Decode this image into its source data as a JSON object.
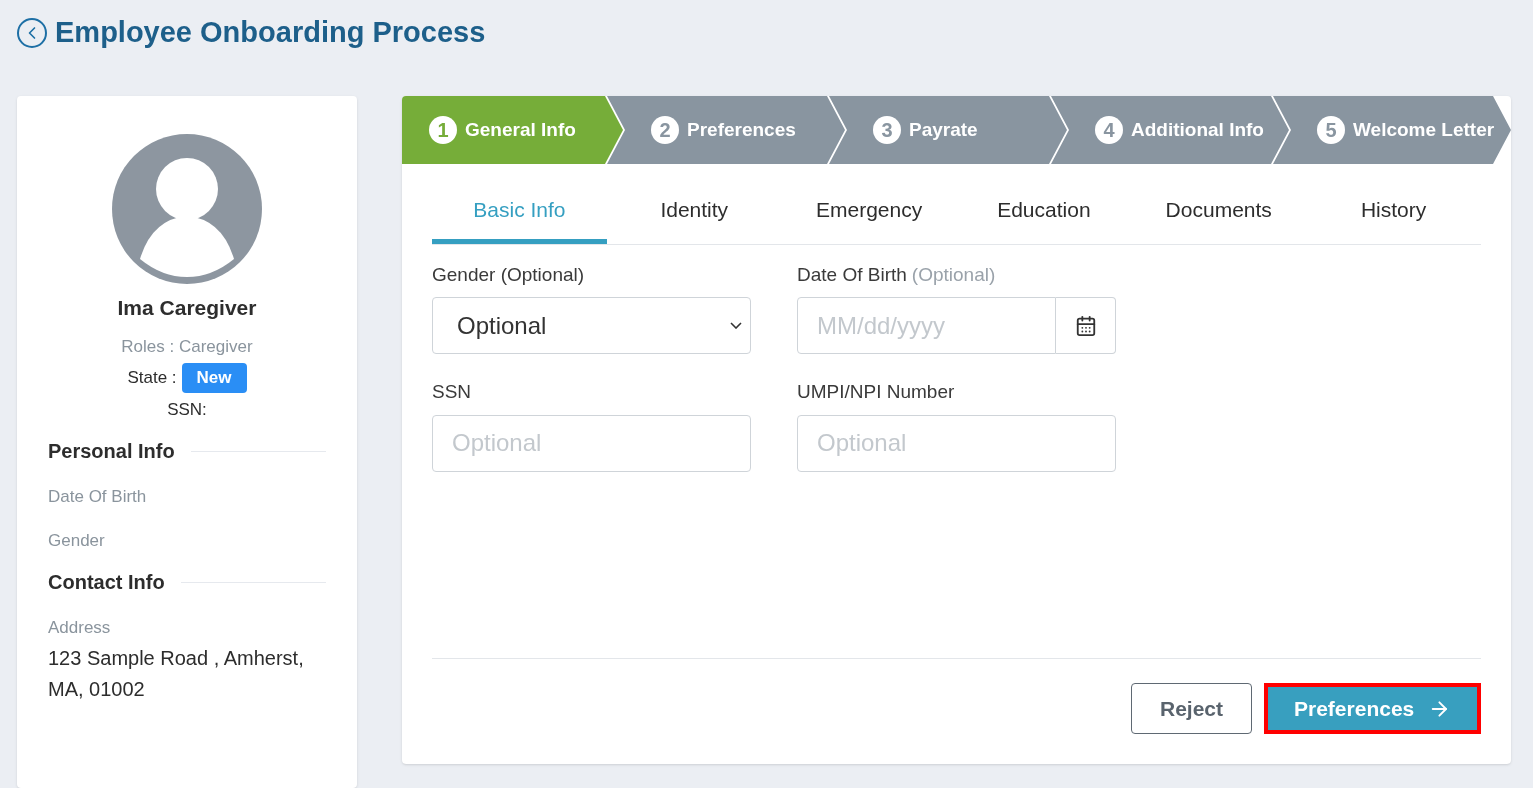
{
  "page": {
    "title": "Employee Onboarding Process"
  },
  "profile": {
    "name": "Ima Caregiver",
    "roles": "Roles : Caregiver",
    "state_label": "State :",
    "state_badge": "New",
    "ssn_label": "SSN:",
    "sections": [
      {
        "title": "Personal Info",
        "items": [
          {
            "label": "Date Of Birth"
          },
          {
            "label": "Gender"
          }
        ]
      },
      {
        "title": "Contact Info",
        "items": [
          {
            "label": "Address",
            "value": "123 Sample Road , Amherst, MA, 01002"
          }
        ]
      }
    ]
  },
  "steps": [
    {
      "number": "1",
      "label": "General Info",
      "selected": true
    },
    {
      "number": "2",
      "label": "Preferences",
      "selected": false
    },
    {
      "number": "3",
      "label": "Payrate",
      "selected": false
    },
    {
      "number": "4",
      "label": "Additional Info",
      "selected": false
    },
    {
      "number": "5",
      "label": "Welcome Letter",
      "selected": false
    }
  ],
  "tabs": [
    {
      "label": "Basic Info",
      "selected": true
    },
    {
      "label": "Identity",
      "selected": false
    },
    {
      "label": "Emergency",
      "selected": false
    },
    {
      "label": "Education",
      "selected": false
    },
    {
      "label": "Documents",
      "selected": false
    },
    {
      "label": "History",
      "selected": false
    }
  ],
  "fields": [
    {
      "kind": "select",
      "label": "Gender (Optional)",
      "value": "Optional"
    },
    {
      "kind": "date",
      "label": "Date Of Birth",
      "hint": "(Optional)",
      "placeholder": "MM/dd/yyyy"
    },
    {
      "kind": "text",
      "label": "SSN",
      "placeholder": "Optional"
    },
    {
      "kind": "text",
      "label": "UMPI/NPI Number",
      "placeholder": "Optional"
    }
  ],
  "buttons": [
    {
      "kind": "secondary",
      "label": "Reject",
      "highlighted": false
    },
    {
      "kind": "primary",
      "label": "Preferences",
      "highlighted": true
    }
  ]
}
